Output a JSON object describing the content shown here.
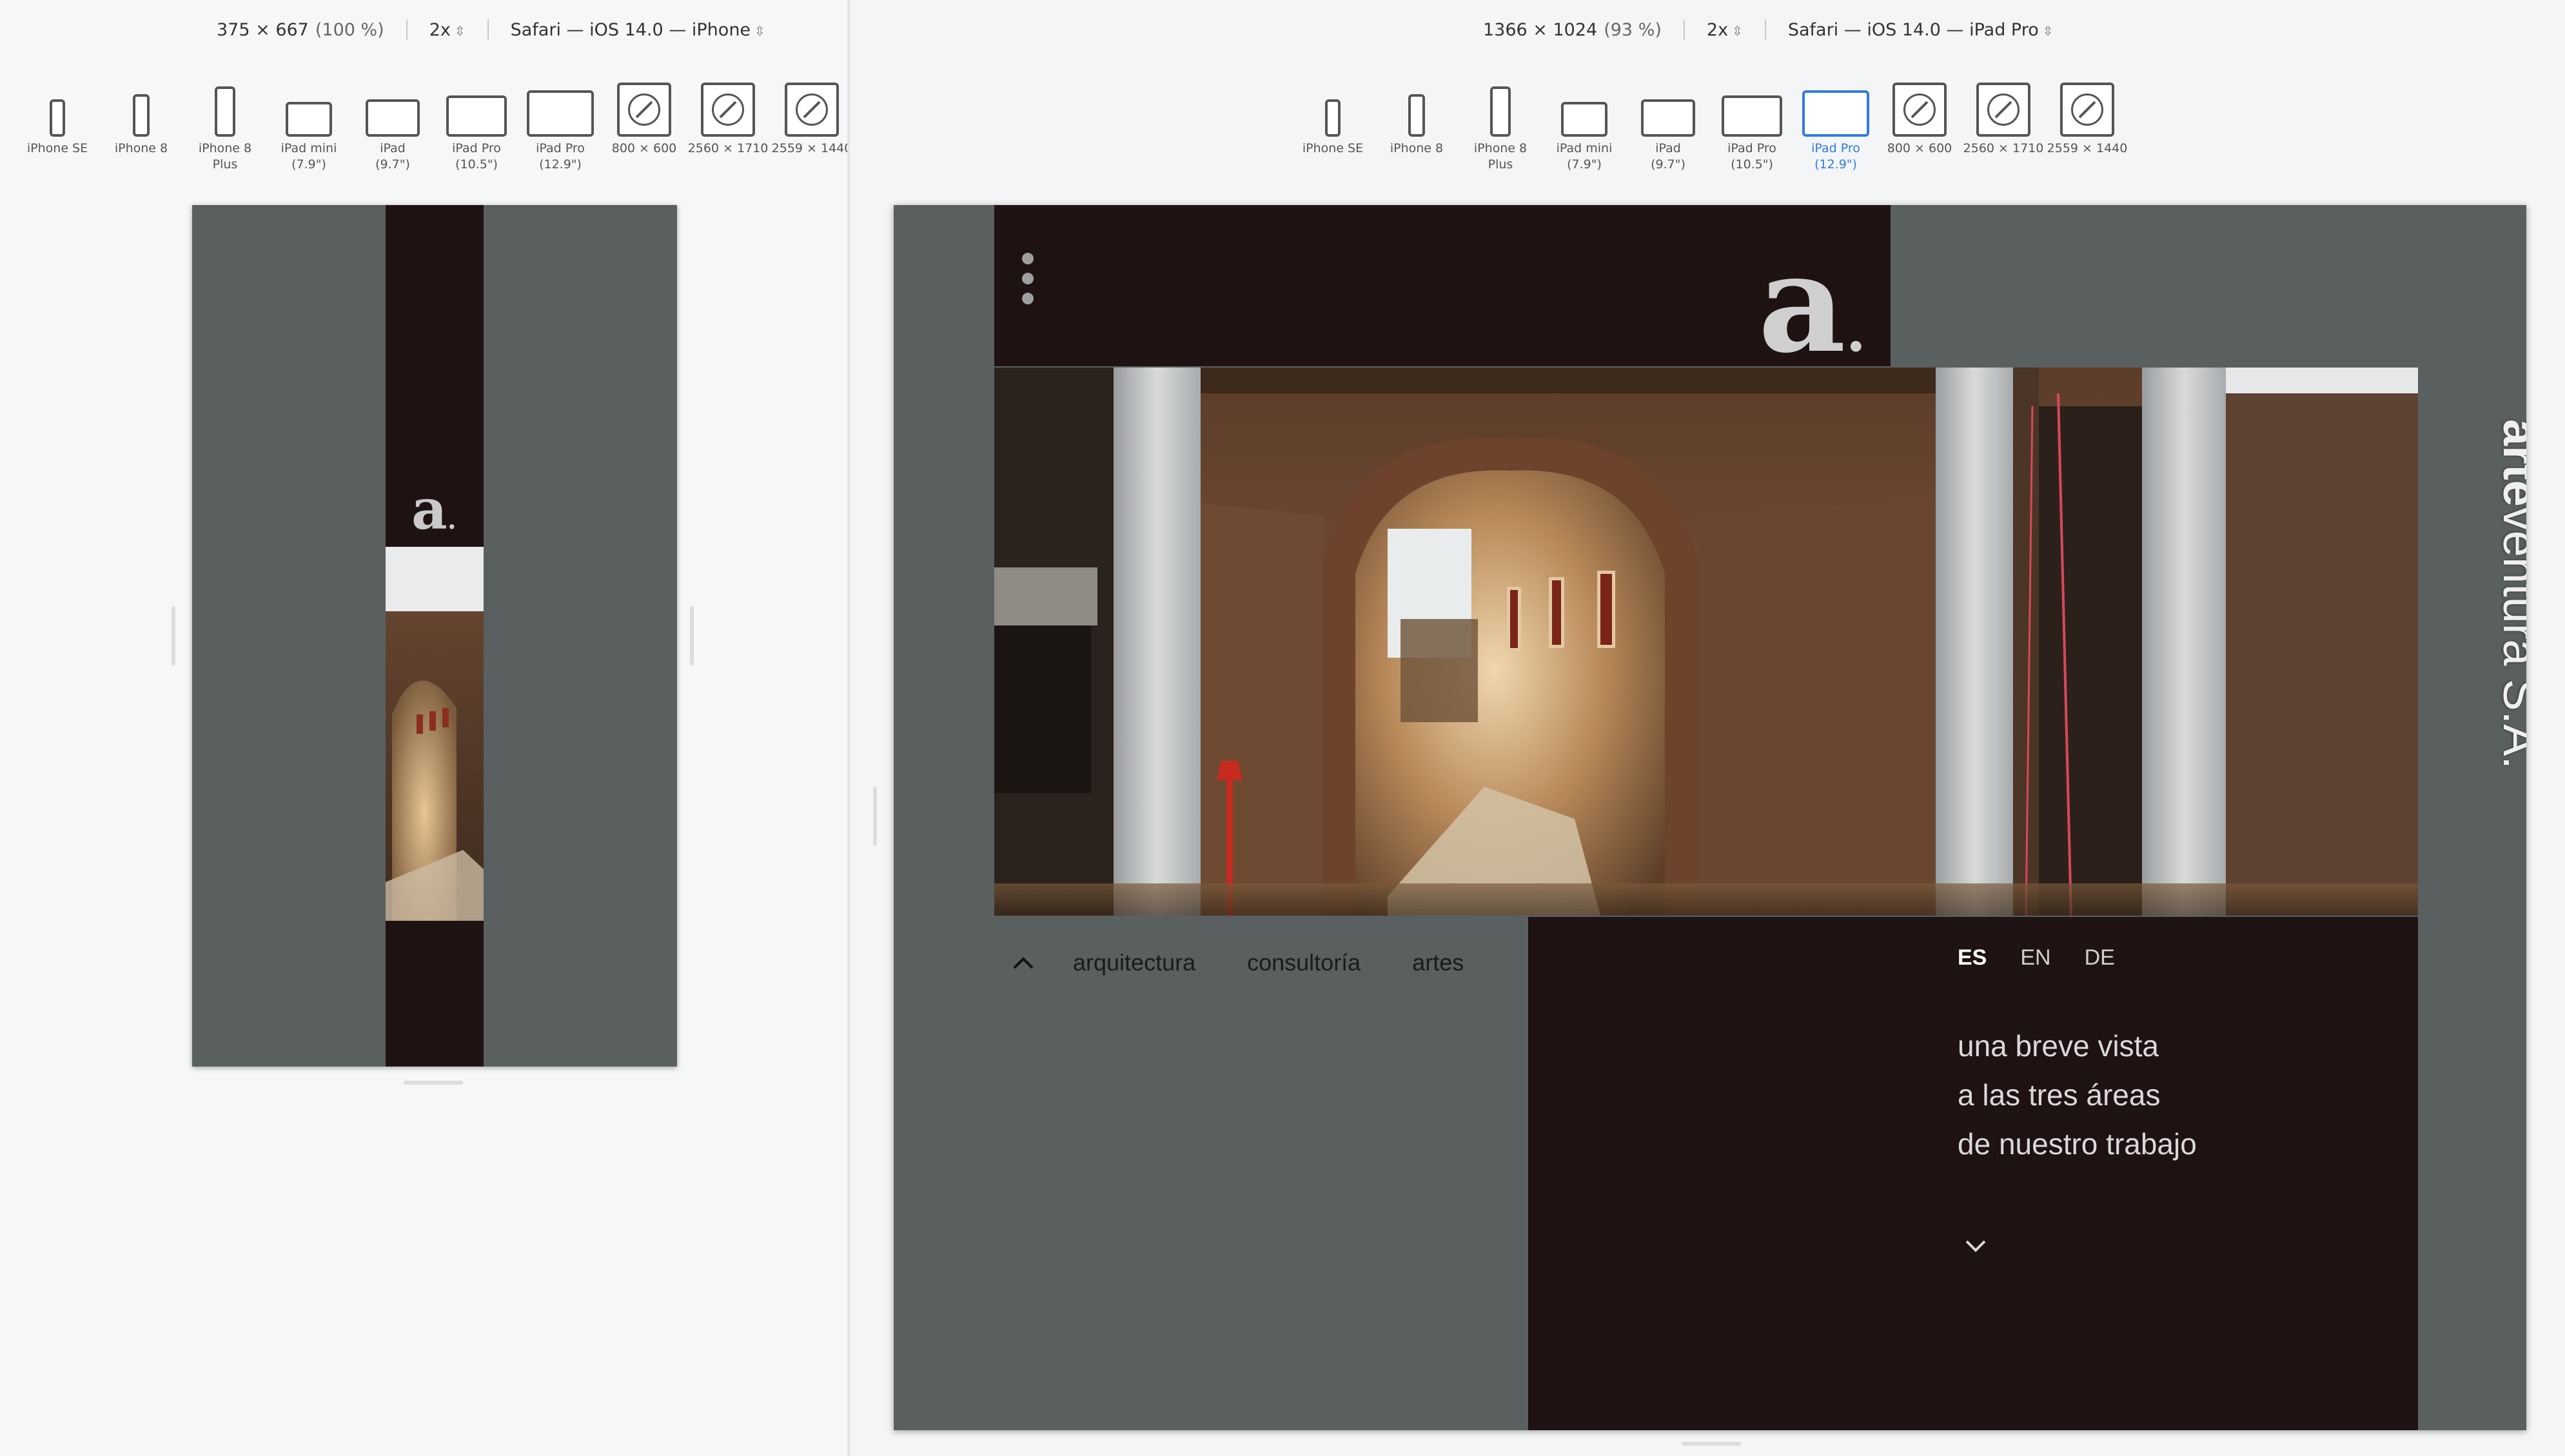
{
  "left_pane": {
    "toolbar": {
      "dimensions": "375 × 667",
      "zoom": "(100 %)",
      "scale": "2x",
      "browser": "Safari — iOS 14.0 — iPhone"
    },
    "devices": [
      {
        "label": "iPhone SE",
        "icon": "iphone-se-icon"
      },
      {
        "label": "iPhone 8",
        "icon": "iphone-8-icon"
      },
      {
        "label": "iPhone 8\nPlus",
        "icon": "iphone-8-plus-icon"
      },
      {
        "label": "iPad mini\n(7.9\")",
        "icon": "ipad-mini-icon"
      },
      {
        "label": "iPad\n(9.7\")",
        "icon": "ipad-icon"
      },
      {
        "label": "iPad Pro\n(10.5\")",
        "icon": "ipad-pro-10-icon"
      },
      {
        "label": "iPad Pro\n(12.9\")",
        "icon": "ipad-pro-12-icon"
      },
      {
        "label": "800 × 600",
        "icon": "safari-compass-icon"
      },
      {
        "label": "2560 × 1710",
        "icon": "safari-compass-icon"
      },
      {
        "label": "2559 × 1440",
        "icon": "safari-compass-icon"
      }
    ],
    "logo": {
      "glyph": "a",
      "dot": "."
    }
  },
  "right_pane": {
    "toolbar": {
      "dimensions": "1366 × 1024",
      "zoom": "(93 %)",
      "scale": "2x",
      "browser": "Safari — iOS 14.0 — iPad Pro"
    },
    "devices": [
      {
        "label": "iPhone SE",
        "icon": "iphone-se-icon"
      },
      {
        "label": "iPhone 8",
        "icon": "iphone-8-icon"
      },
      {
        "label": "iPhone 8\nPlus",
        "icon": "iphone-8-plus-icon"
      },
      {
        "label": "iPad mini\n(7.9\")",
        "icon": "ipad-mini-icon"
      },
      {
        "label": "iPad\n(9.7\")",
        "icon": "ipad-icon"
      },
      {
        "label": "iPad Pro\n(10.5\")",
        "icon": "ipad-pro-10-icon"
      },
      {
        "label": "iPad Pro\n(12.9\")",
        "icon": "ipad-pro-12-icon",
        "active": true
      },
      {
        "label": "800 × 600",
        "icon": "safari-compass-icon"
      },
      {
        "label": "2560 × 1710",
        "icon": "safari-compass-icon"
      },
      {
        "label": "2559 × 1440",
        "icon": "safari-compass-icon"
      }
    ],
    "active_device": "iPad Pro (12.9\")"
  },
  "site": {
    "logo": {
      "glyph": "a",
      "dot": "."
    },
    "brand": {
      "bold": "arte",
      "rest": "ventura S.A."
    },
    "nav": {
      "items": [
        "arquitectura",
        "consultoría",
        "artes"
      ]
    },
    "languages": [
      {
        "code": "ES",
        "active": true
      },
      {
        "code": "EN",
        "active": false
      },
      {
        "code": "DE",
        "active": false
      }
    ],
    "tagline": [
      "una breve vista",
      "a las tres áreas",
      "de nuestro trabajo"
    ]
  },
  "colors": {
    "active_blue": "#2f7be5",
    "site_dark": "#1f1213",
    "site_gray": "#5a5f60",
    "logo_gray": "#cfcfcf"
  }
}
